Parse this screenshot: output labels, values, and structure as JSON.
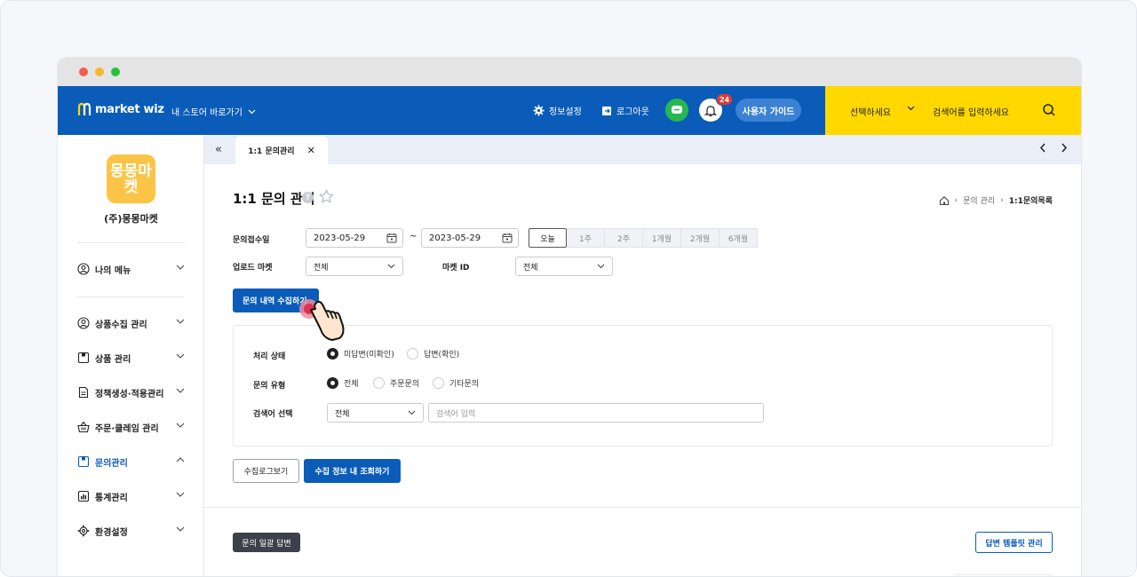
{
  "topbar": {
    "logo_text": "market wiz",
    "store_link": "내 스토어 바로가기",
    "settings": "정보설정",
    "logout": "로그아웃",
    "notif_count": "24",
    "guide": "사용자 가이드",
    "search_select": "선택하세요",
    "search_placeholder": "검색어를 입력하세요"
  },
  "sidebar": {
    "store_logo": "몽몽마켓",
    "store_name": "(주)몽몽마켓",
    "my_menu": "나의 메뉴",
    "items": [
      {
        "label": "상품수집 관리"
      },
      {
        "label": "상품 관리"
      },
      {
        "label": "정책생성·적용관리"
      },
      {
        "label": "주문·클레임 관리"
      },
      {
        "label": "문의관리"
      },
      {
        "label": "통계관리"
      },
      {
        "label": "환경설정"
      }
    ]
  },
  "tabs": {
    "active": "1:1 문의관리"
  },
  "page": {
    "title": "1:1 문의 관리",
    "breadcrumb": [
      "문의 관리",
      "1:1문의목록"
    ]
  },
  "form": {
    "date_label": "문의접수일",
    "date_from": "2023-05-29",
    "date_to": "2023-05-29",
    "date_sep": "~",
    "ranges": [
      "오늘",
      "1주",
      "2주",
      "1개월",
      "2개월",
      "6개월"
    ],
    "upload_market_label": "업로드 마켓",
    "upload_market_value": "전체",
    "market_id_label": "마켓 ID",
    "market_id_value": "전체",
    "collect_button": "문의 내역 수집하기"
  },
  "filter": {
    "status_label": "처리 상태",
    "status_options": [
      "미답변(미확인)",
      "답변(확인)"
    ],
    "type_label": "문의 유형",
    "type_options": [
      "전체",
      "주문문의",
      "기타문의"
    ],
    "keyword_label": "검색어 선택",
    "keyword_select": "전체",
    "keyword_placeholder": "검색어 입력"
  },
  "actions": {
    "log_button": "수집로그보기",
    "view_button": "수집 정보 내 조회하기",
    "bulk_button": "문의 일괄 답변",
    "template_button": "답변 템플릿 관리"
  },
  "colors": {
    "brand": "#0a5cb8",
    "accent": "#ffd800",
    "chat": "#27b84f",
    "badge": "#e53935"
  }
}
